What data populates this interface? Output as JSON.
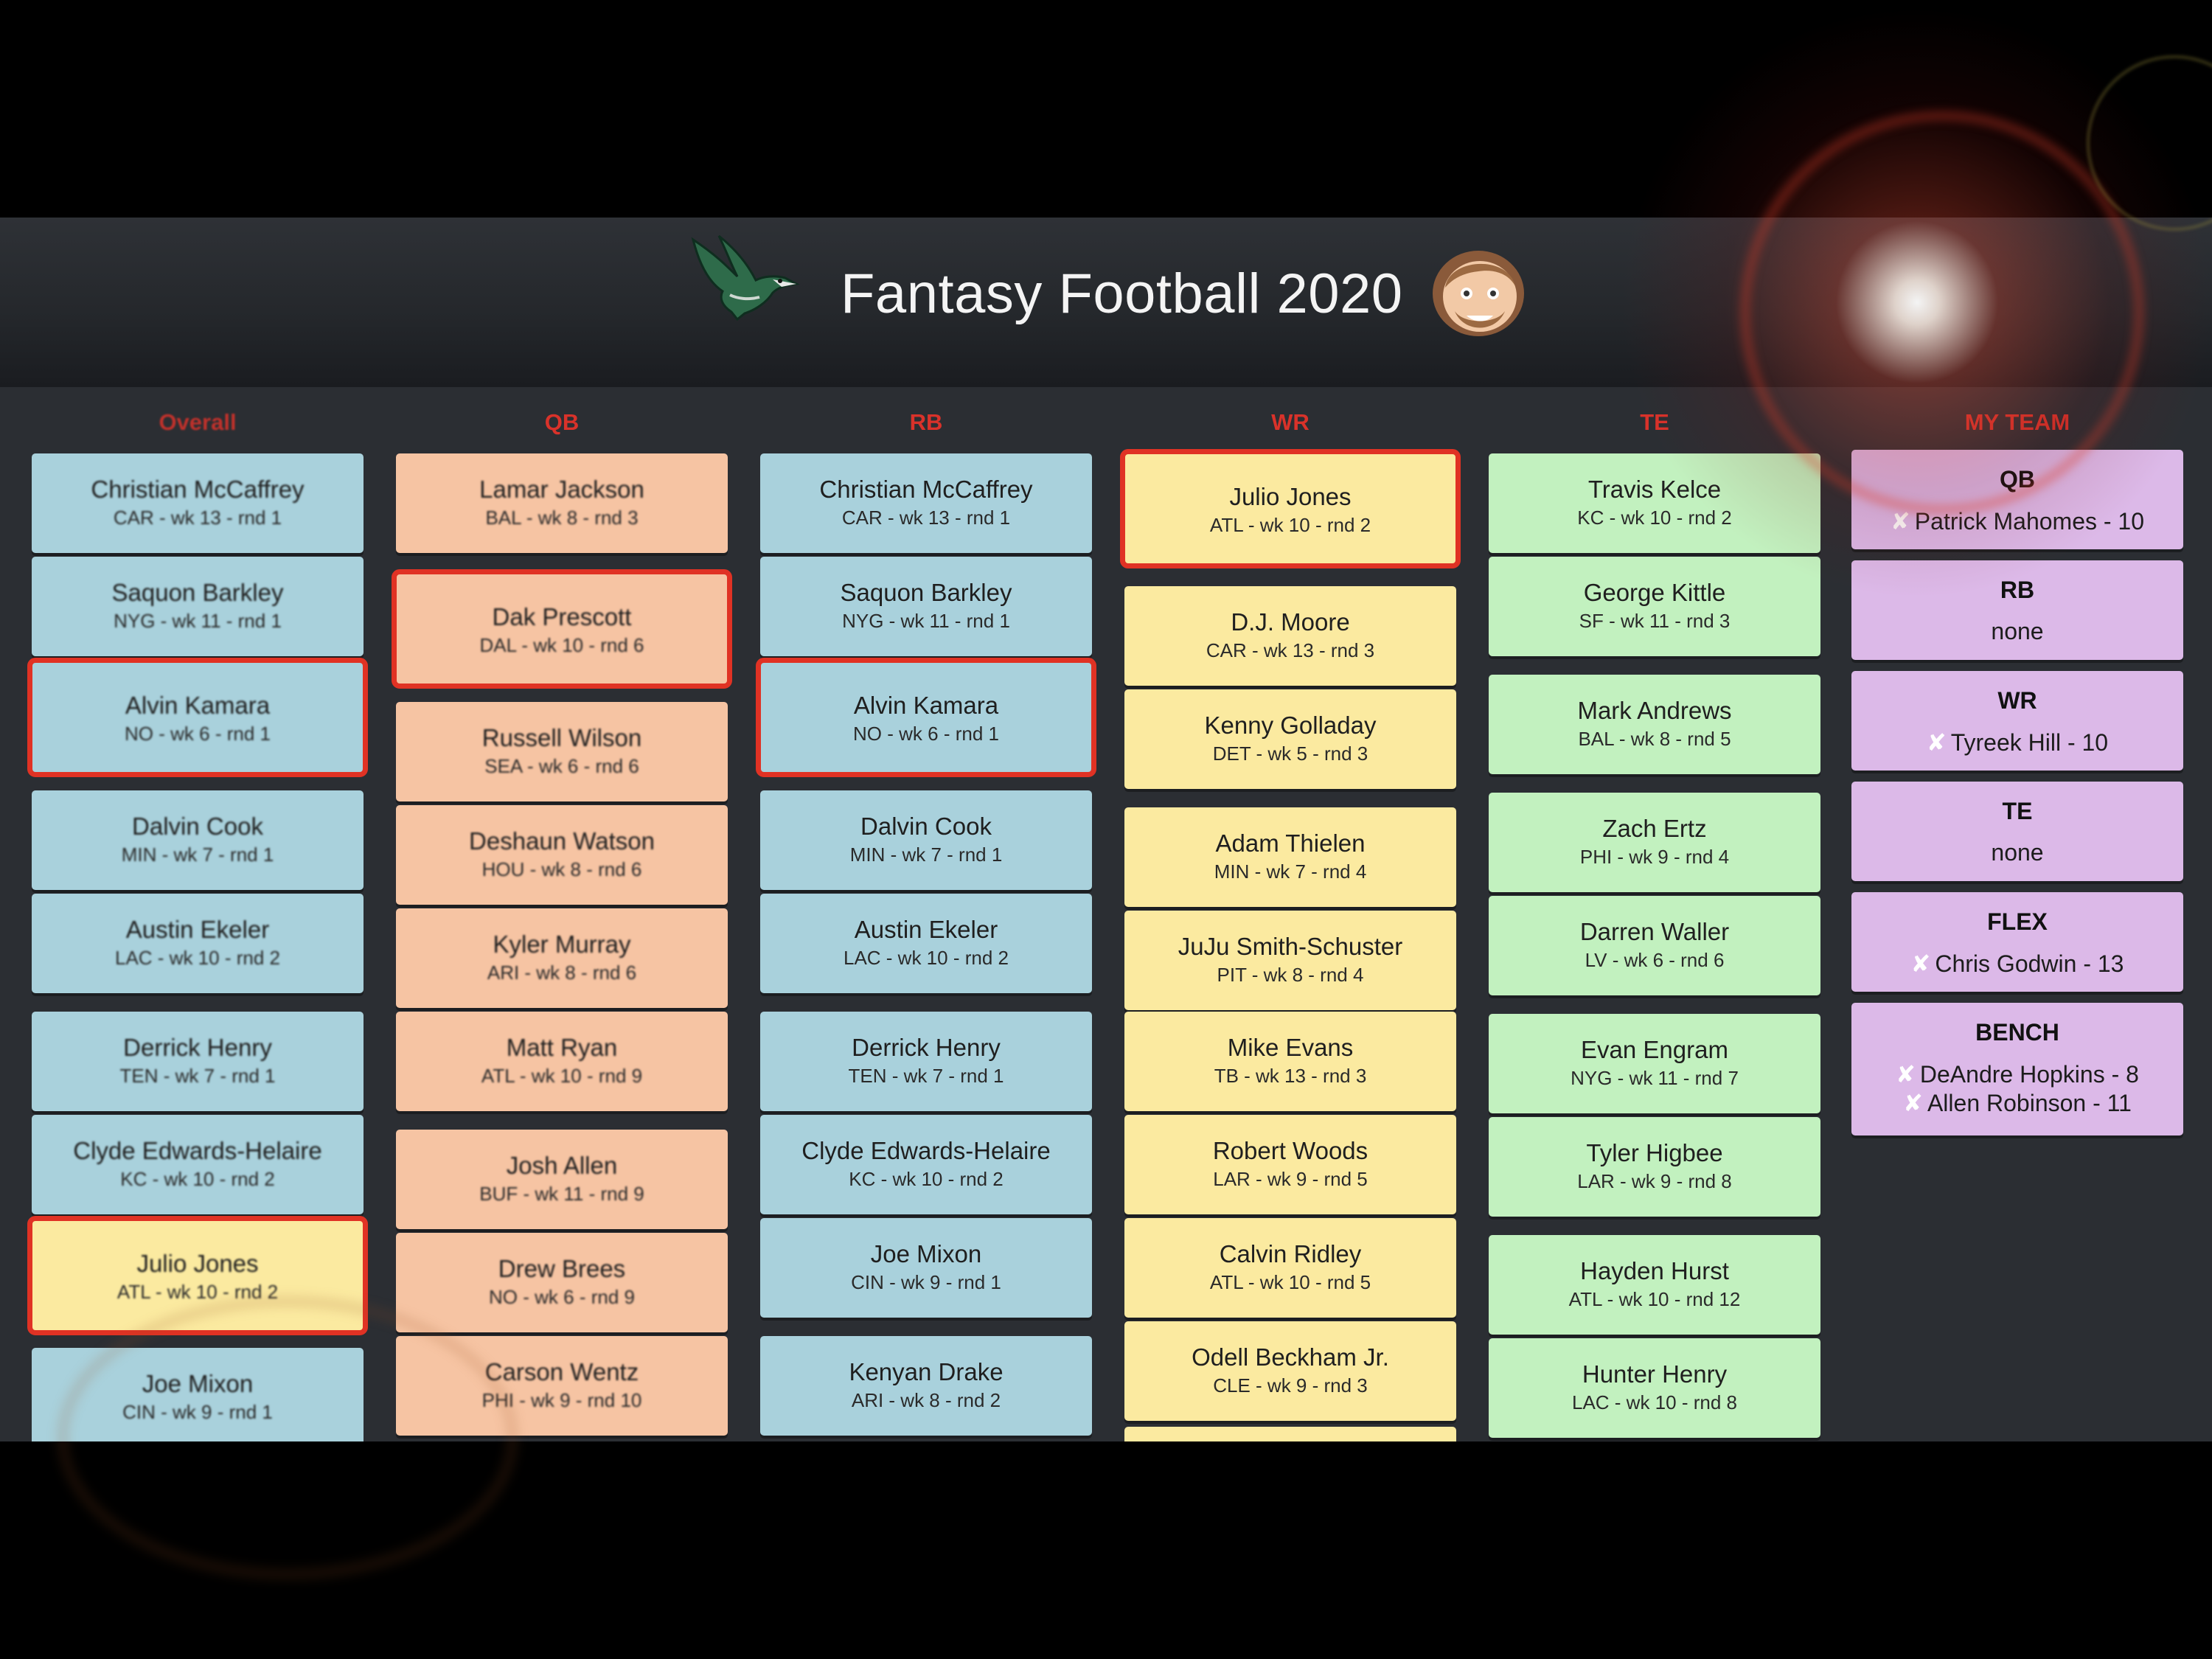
{
  "app": {
    "title": "Fantasy Football 2020",
    "logo_icon": "eagle-logo-icon",
    "avatar_icon": "cartoon-avatar-icon"
  },
  "colors": {
    "accent_red": "#e03224",
    "blue_card": "#a9d1dc",
    "orange_card": "#f6c4a3",
    "yellow_card": "#fbeaa0",
    "green_card": "#c2f1bf",
    "purple_card": "#dcb9e8"
  },
  "columns": {
    "overall": {
      "header": "Overall",
      "cards": [
        {
          "name": "Christian McCaffrey",
          "sub": "CAR - wk 13 - rnd 1"
        },
        {
          "name": "Saquon Barkley",
          "sub": "NYG - wk 11 - rnd 1"
        },
        {
          "name": "Alvin Kamara",
          "sub": "NO - wk 6 - rnd 1"
        },
        {
          "name": "Dalvin Cook",
          "sub": "MIN - wk 7 - rnd 1"
        },
        {
          "name": "Austin Ekeler",
          "sub": "LAC - wk 10 - rnd 2"
        },
        {
          "name": "Derrick Henry",
          "sub": "TEN - wk 7 - rnd 1"
        },
        {
          "name": "Clyde Edwards-Helaire",
          "sub": "KC - wk 10 - rnd 2"
        },
        {
          "name": "Julio Jones",
          "sub": "ATL - wk 10 - rnd 2"
        },
        {
          "name": "Joe Mixon",
          "sub": "CIN - wk 9 - rnd 1"
        }
      ]
    },
    "qb": {
      "header": "QB",
      "cards": [
        {
          "name": "Lamar Jackson",
          "sub": "BAL - wk 8 - rnd 3"
        },
        {
          "name": "Dak Prescott",
          "sub": "DAL - wk 10 - rnd 6"
        },
        {
          "name": "Russell Wilson",
          "sub": "SEA - wk 6 - rnd 6"
        },
        {
          "name": "Deshaun Watson",
          "sub": "HOU - wk 8 - rnd 6"
        },
        {
          "name": "Kyler Murray",
          "sub": "ARI - wk 8 - rnd 6"
        },
        {
          "name": "Matt Ryan",
          "sub": "ATL - wk 10 - rnd 9"
        },
        {
          "name": "Josh Allen",
          "sub": "BUF - wk 11 - rnd 9"
        },
        {
          "name": "Drew Brees",
          "sub": "NO - wk 6 - rnd 9"
        },
        {
          "name": "Carson Wentz",
          "sub": "PHI - wk 9 - rnd 10"
        }
      ]
    },
    "rb": {
      "header": "RB",
      "cards": [
        {
          "name": "Christian McCaffrey",
          "sub": "CAR - wk 13 - rnd 1"
        },
        {
          "name": "Saquon Barkley",
          "sub": "NYG - wk 11 - rnd 1"
        },
        {
          "name": "Alvin Kamara",
          "sub": "NO - wk 6 - rnd 1"
        },
        {
          "name": "Dalvin Cook",
          "sub": "MIN - wk 7 - rnd 1"
        },
        {
          "name": "Austin Ekeler",
          "sub": "LAC - wk 10 - rnd 2"
        },
        {
          "name": "Derrick Henry",
          "sub": "TEN - wk 7 - rnd 1"
        },
        {
          "name": "Clyde Edwards-Helaire",
          "sub": "KC - wk 10 - rnd 2"
        },
        {
          "name": "Joe Mixon",
          "sub": "CIN - wk 9 - rnd 1"
        },
        {
          "name": "Kenyan Drake",
          "sub": "ARI - wk 8 - rnd 2"
        }
      ]
    },
    "wr": {
      "header": "WR",
      "cards": [
        {
          "name": "Julio Jones",
          "sub": "ATL - wk 10 - rnd 2"
        },
        {
          "name": "D.J. Moore",
          "sub": "CAR - wk 13 - rnd 3"
        },
        {
          "name": "Kenny Golladay",
          "sub": "DET - wk 5 - rnd 3"
        },
        {
          "name": "Adam Thielen",
          "sub": "MIN - wk 7 - rnd 4"
        },
        {
          "name": "JuJu Smith-Schuster",
          "sub": "PIT - wk 8 - rnd 4"
        },
        {
          "name": "Mike Evans",
          "sub": "TB - wk 13 - rnd 3"
        },
        {
          "name": "Robert Woods",
          "sub": "LAR - wk 9 - rnd 5"
        },
        {
          "name": "Calvin Ridley",
          "sub": "ATL - wk 10 - rnd 5"
        },
        {
          "name": "Odell Beckham Jr.",
          "sub": "CLE - wk 9 - rnd 3"
        }
      ]
    },
    "te": {
      "header": "TE",
      "cards": [
        {
          "name": "Travis Kelce",
          "sub": "KC - wk 10 - rnd 2"
        },
        {
          "name": "George Kittle",
          "sub": "SF - wk 11 - rnd 3"
        },
        {
          "name": "Mark Andrews",
          "sub": "BAL - wk 8 - rnd 5"
        },
        {
          "name": "Zach Ertz",
          "sub": "PHI - wk 9 - rnd 4"
        },
        {
          "name": "Darren Waller",
          "sub": "LV - wk 6 - rnd 6"
        },
        {
          "name": "Evan Engram",
          "sub": "NYG - wk 11 - rnd 7"
        },
        {
          "name": "Tyler Higbee",
          "sub": "LAR - wk 9 - rnd 8"
        },
        {
          "name": "Hayden Hurst",
          "sub": "ATL - wk 10 - rnd 12"
        },
        {
          "name": "Hunter Henry",
          "sub": "LAC - wk 10 - rnd 8"
        }
      ]
    }
  },
  "my_team": {
    "header": "MY TEAM",
    "slots": [
      {
        "pos": "QB",
        "players": [
          "Patrick Mahomes - 10"
        ]
      },
      {
        "pos": "RB",
        "none_text": "none"
      },
      {
        "pos": "WR",
        "players": [
          "Tyreek Hill - 10"
        ]
      },
      {
        "pos": "TE",
        "none_text": "none"
      },
      {
        "pos": "FLEX",
        "players": [
          "Chris Godwin - 13"
        ]
      },
      {
        "pos": "BENCH",
        "players": [
          "DeAndre Hopkins - 8",
          "Allen Robinson - 11"
        ]
      }
    ],
    "remove_icon": "x-remove-icon",
    "remove_glyph": "✘"
  }
}
